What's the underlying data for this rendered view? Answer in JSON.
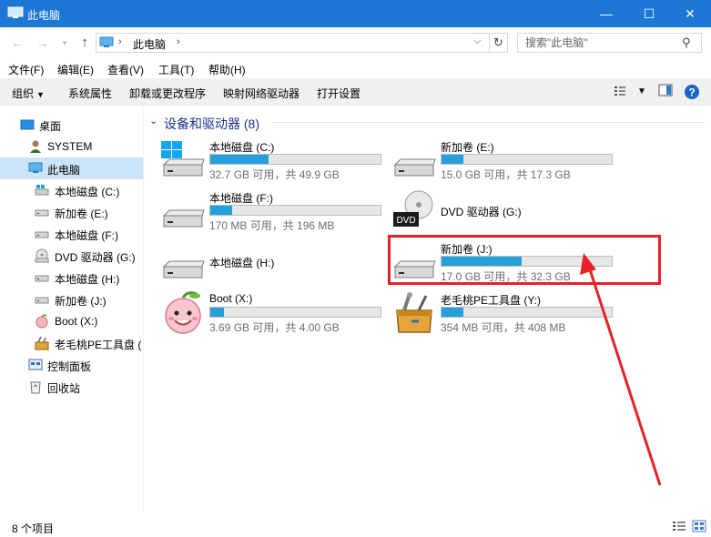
{
  "window": {
    "title": "此电脑",
    "minimize_glyph": "—",
    "maximize_glyph": "☐",
    "close_glyph": "✕"
  },
  "address": {
    "crumb": "此电脑",
    "search_placeholder": "搜索\"此电脑\""
  },
  "menu": [
    "文件(F)",
    "编辑(E)",
    "查看(V)",
    "工具(T)",
    "帮助(H)"
  ],
  "toolbar": {
    "organize": "组织",
    "system_properties": "系统属性",
    "uninstall": "卸载或更改程序",
    "map_drive": "映射网络驱动器",
    "open_settings": "打开设置"
  },
  "sidebar": {
    "items": [
      {
        "label": "桌面",
        "icon": "desktop-icon"
      },
      {
        "label": "SYSTEM",
        "icon": "user-icon"
      },
      {
        "label": "此电脑",
        "icon": "computer-icon"
      },
      {
        "label": "本地磁盘 (C:)",
        "icon": "windows-drive-icon"
      },
      {
        "label": "新加卷 (E:)",
        "icon": "drive-icon"
      },
      {
        "label": "本地磁盘 (F:)",
        "icon": "drive-icon"
      },
      {
        "label": "DVD 驱动器 (G:)",
        "icon": "dvd-icon"
      },
      {
        "label": "本地磁盘 (H:)",
        "icon": "drive-icon"
      },
      {
        "label": "新加卷 (J:)",
        "icon": "drive-icon"
      },
      {
        "label": "Boot (X:)",
        "icon": "peach-icon"
      },
      {
        "label": "老毛桃PE工具盘 (",
        "icon": "toolbox-icon"
      },
      {
        "label": "控制面板",
        "icon": "control-panel-icon"
      },
      {
        "label": "回收站",
        "icon": "recycle-bin-icon"
      }
    ]
  },
  "group": {
    "title": "设备和驱动器 (8)"
  },
  "drives": [
    {
      "name": "本地磁盘 (C:)",
      "size": "32.7 GB 可用，共 49.9 GB",
      "used_fraction": 0.34,
      "icon": "windows-drive-icon"
    },
    {
      "name": "新加卷 (E:)",
      "size": "15.0 GB 可用，共 17.3 GB",
      "used_fraction": 0.13,
      "icon": "drive-icon"
    },
    {
      "name": "本地磁盘 (F:)",
      "size": "170 MB 可用，共 196 MB",
      "used_fraction": 0.13,
      "icon": "drive-icon"
    },
    {
      "name": "DVD 驱动器 (G:)",
      "size": "",
      "used_fraction": null,
      "icon": "dvd-icon"
    },
    {
      "name": "本地磁盘 (H:)",
      "size": "",
      "used_fraction": null,
      "icon": "drive-icon"
    },
    {
      "name": "新加卷 (J:)",
      "size": "17.0 GB 可用，共 32.3 GB",
      "used_fraction": 0.47,
      "icon": "drive-icon"
    },
    {
      "name": "Boot (X:)",
      "size": "3.69 GB 可用，共 4.00 GB",
      "used_fraction": 0.08,
      "icon": "peach-icon"
    },
    {
      "name": "老毛桃PE工具盘 (Y:)",
      "size": "354 MB 可用，共 408 MB",
      "used_fraction": 0.13,
      "icon": "toolbox-icon"
    }
  ],
  "status": {
    "count": "8 个项目"
  },
  "colors": {
    "accent": "#1c78d4",
    "bar_fill": "#26a0da",
    "annotation": "#e8202a"
  }
}
